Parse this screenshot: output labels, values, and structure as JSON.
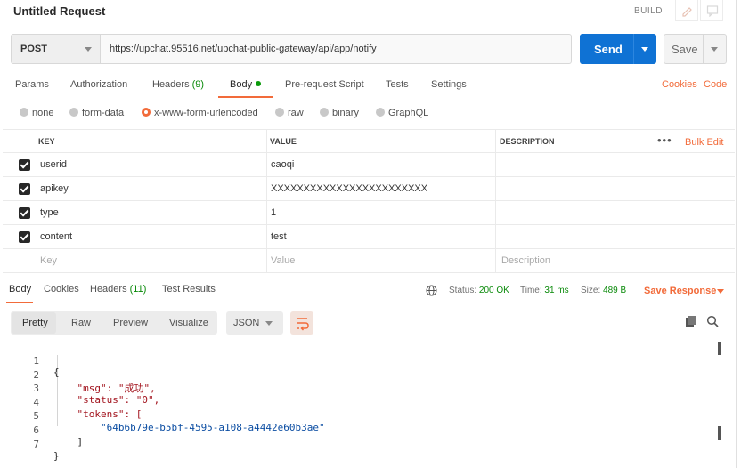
{
  "header": {
    "title": "Untitled Request",
    "build_label": "BUILD"
  },
  "request": {
    "method": "POST",
    "url": "https://upchat.95516.net/upchat-public-gateway/api/app/notify",
    "send_label": "Send",
    "save_label": "Save"
  },
  "tabs": {
    "params": "Params",
    "authorization": "Authorization",
    "headers": "Headers",
    "headers_count": "(9)",
    "body": "Body",
    "prerequest": "Pre-request Script",
    "tests": "Tests",
    "settings": "Settings",
    "cookies": "Cookies",
    "code": "Code"
  },
  "body_types": {
    "none": "none",
    "form_data": "form-data",
    "urlencoded": "x-www-form-urlencoded",
    "raw": "raw",
    "binary": "binary",
    "graphql": "GraphQL",
    "selected": "x-www-form-urlencoded"
  },
  "params_table": {
    "headers": {
      "key": "KEY",
      "value": "VALUE",
      "description": "DESCRIPTION",
      "bulk_edit": "Bulk Edit"
    },
    "rows": [
      {
        "key": "userid",
        "value": "caoqi",
        "description": ""
      },
      {
        "key": "apikey",
        "value": "XXXXXXXXXXXXXXXXXXXXXXXX",
        "description": ""
      },
      {
        "key": "type",
        "value": "1",
        "description": ""
      },
      {
        "key": "content",
        "value": "test",
        "description": ""
      }
    ],
    "placeholder": {
      "key": "Key",
      "value": "Value",
      "description": "Description"
    }
  },
  "response": {
    "tabs": {
      "body": "Body",
      "cookies": "Cookies",
      "headers": "Headers",
      "headers_count": "(11)",
      "test_results": "Test Results"
    },
    "status_label": "Status:",
    "status_value": "200 OK",
    "time_label": "Time:",
    "time_value": "31 ms",
    "size_label": "Size:",
    "size_value": "489 B",
    "save_response": "Save Response",
    "view_tabs": {
      "pretty": "Pretty",
      "raw": "Raw",
      "preview": "Preview",
      "visualize": "Visualize"
    },
    "format": "JSON",
    "code_lines": [
      {
        "num": "1",
        "text": "{"
      },
      {
        "num": "2",
        "text": "    \"msg\": \"成功\","
      },
      {
        "num": "3",
        "text": "    \"status\": \"0\","
      },
      {
        "num": "4",
        "text": "    \"tokens\": ["
      },
      {
        "num": "5",
        "text": "        \"64b6b79e-b5bf-4595-a108-a4442e60b3ae\""
      },
      {
        "num": "6",
        "text": "    ]"
      },
      {
        "num": "7",
        "text": "}"
      }
    ]
  },
  "colors": {
    "accent": "#f26b3a",
    "send": "#0f72d4",
    "status_ok": "#0a8a0a"
  }
}
